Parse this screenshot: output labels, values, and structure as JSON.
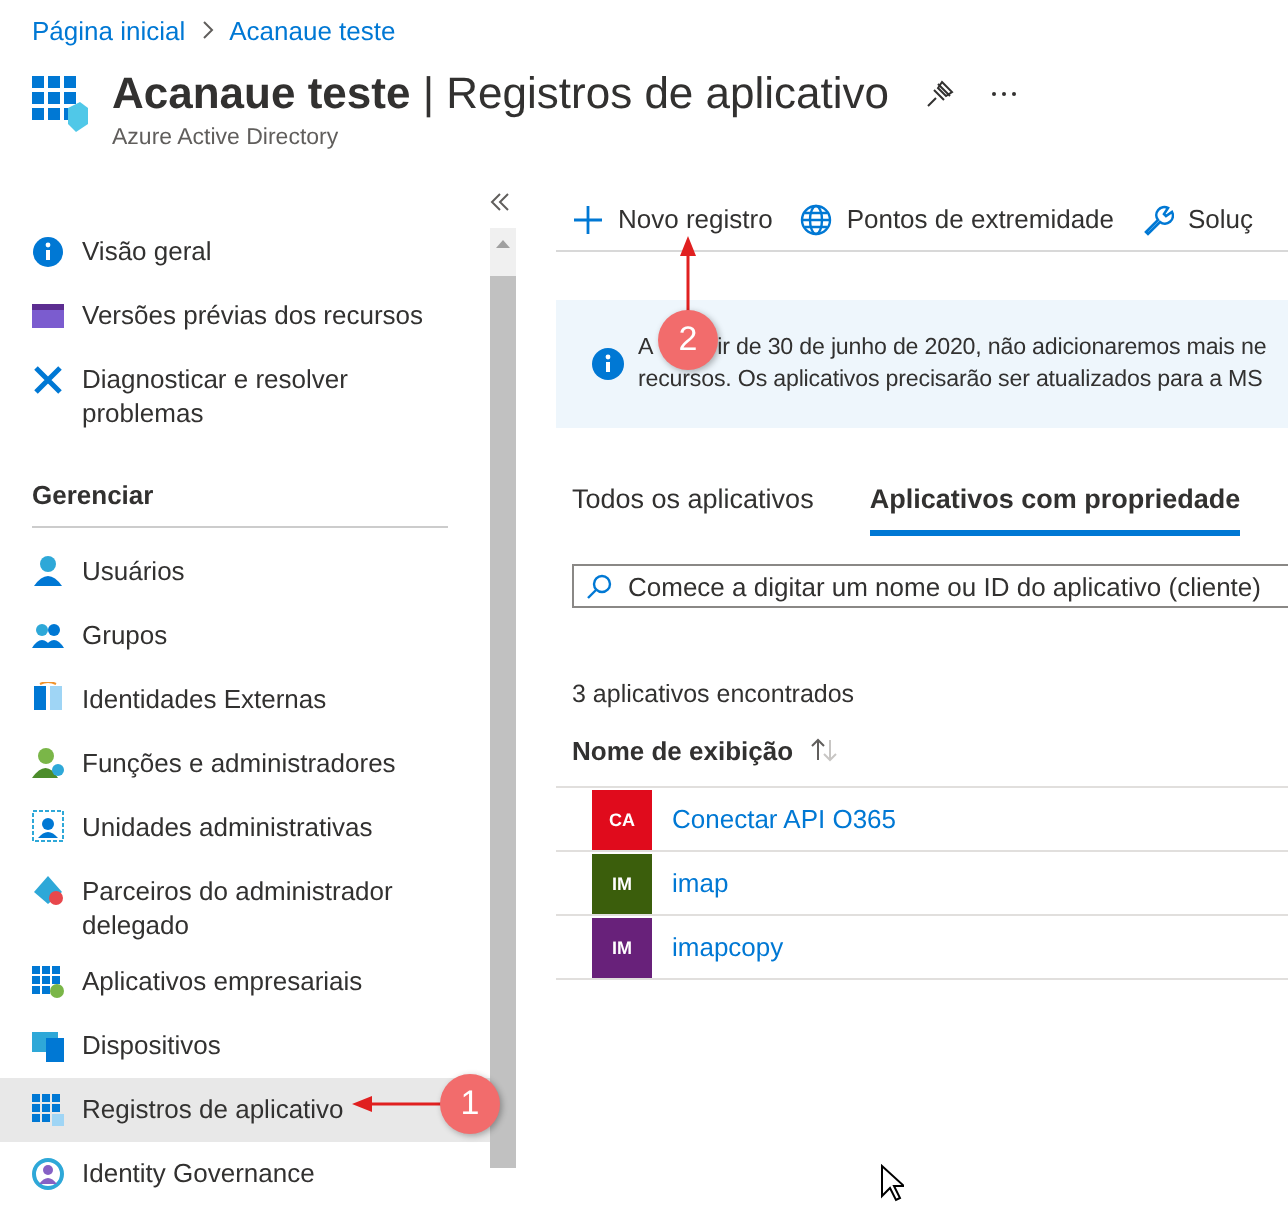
{
  "breadcrumb": [
    {
      "label": "Página inicial"
    },
    {
      "label": "Acanaue teste"
    }
  ],
  "header": {
    "title": "Acanaue teste",
    "separator": "|",
    "page": "Registros de aplicativo",
    "subtitle": "Azure Active Directory"
  },
  "sidebar": {
    "top_items": [
      {
        "label": "Visão geral",
        "selected": false
      },
      {
        "label": "Versões prévias dos recursos",
        "selected": false
      },
      {
        "label": "Diagnosticar e resolver problemas",
        "selected": false
      }
    ],
    "section": "Gerenciar",
    "items": [
      {
        "label": "Usuários",
        "selected": false
      },
      {
        "label": "Grupos",
        "selected": false
      },
      {
        "label": "Identidades Externas",
        "selected": false
      },
      {
        "label": "Funções e administradores",
        "selected": false
      },
      {
        "label": "Unidades administrativas",
        "selected": false
      },
      {
        "label": "Parceiros do administrador delegado",
        "selected": false
      },
      {
        "label": "Aplicativos empresariais",
        "selected": false
      },
      {
        "label": "Dispositivos",
        "selected": false
      },
      {
        "label": "Registros de aplicativo",
        "selected": true
      },
      {
        "label": "Identity Governance",
        "selected": false
      }
    ]
  },
  "toolbar": [
    {
      "label": "Novo registro"
    },
    {
      "label": "Pontos de extremidade"
    },
    {
      "label": "Soluç"
    }
  ],
  "banner": {
    "line_1_start": "A",
    "line_1_end": "ir de 30 de junho de 2020, não adicionaremos mais ne",
    "line_2": "recursos. Os aplicativos precisarão ser atualizados para a MS"
  },
  "tabs": [
    {
      "label": "Todos os aplicativos",
      "selected": false
    },
    {
      "label": "Aplicativos com propriedade",
      "selected": true
    }
  ],
  "search": {
    "placeholder": "Comece a digitar um nome ou ID do aplicativo (cliente)"
  },
  "count": "3 aplicativos encontrados",
  "table": {
    "columns": [
      "Nome de exibição"
    ],
    "rows": [
      {
        "initials": "CA",
        "name": "Conectar API O365",
        "color": "#e00b1c"
      },
      {
        "initials": "IM",
        "name": "imap",
        "color": "#3b5e0c"
      },
      {
        "initials": "IM",
        "name": "imapcopy",
        "color": "#68217a"
      }
    ]
  },
  "annotations": [
    {
      "label": "1"
    },
    {
      "label": "2"
    }
  ]
}
